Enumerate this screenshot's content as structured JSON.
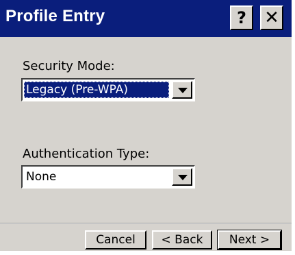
{
  "window": {
    "title": "Profile Entry",
    "help_button": "?",
    "close_button": "✕"
  },
  "security_mode": {
    "label": "Security Mode:",
    "value": "Legacy (Pre-WPA)"
  },
  "authentication_type": {
    "label": "Authentication Type:",
    "value": "None"
  },
  "buttons": {
    "cancel": "Cancel",
    "back": "< Back",
    "next": "Next >"
  },
  "colors": {
    "title_bar": "#0a1e7c",
    "dialog_bg": "#d6d3ce",
    "selection": "#0a1e7c"
  }
}
